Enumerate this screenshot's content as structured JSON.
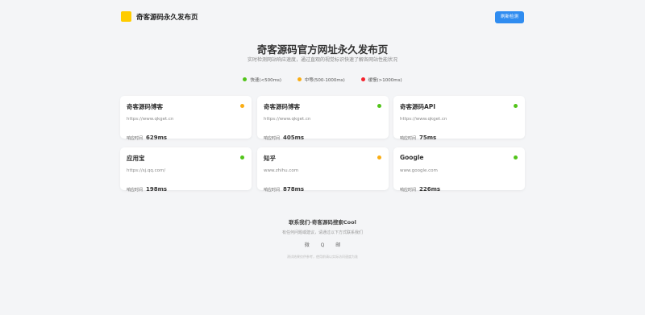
{
  "header": {
    "site_title": "奇客源码永久发布页",
    "refresh_label": "刷新检测",
    "logo_color": "#ffcc00",
    "refresh_color": "#2f8cf0"
  },
  "main": {
    "title": "奇客源码官方网址永久发布页",
    "subtitle": "实时检测网站响应速度，通过直观的视觉标识快速了解各网站性能状况"
  },
  "legend": [
    {
      "label": "快速(<500ms)",
      "color": "#52c41a"
    },
    {
      "label": "中等(500-1000ms)",
      "color": "#faad14"
    },
    {
      "label": "缓慢(>1000ms)",
      "color": "#f5222d"
    }
  ],
  "response_label": "响应时间",
  "sites": [
    {
      "name": "奇客源码博客",
      "url": "https://www.qkget.cn",
      "time": "629ms",
      "status": "medium",
      "color": "#faad14"
    },
    {
      "name": "奇客源码博客",
      "url": "https://www.qkget.cn",
      "time": "405ms",
      "status": "fast",
      "color": "#52c41a"
    },
    {
      "name": "奇客源码API",
      "url": "https://www.qkget.cn",
      "time": "75ms",
      "status": "fast",
      "color": "#52c41a"
    },
    {
      "name": "应用宝",
      "url": "https://sj.qq.com/",
      "time": "198ms",
      "status": "fast",
      "color": "#52c41a"
    },
    {
      "name": "知乎",
      "url": "www.zhihu.com",
      "time": "878ms",
      "status": "medium",
      "color": "#faad14"
    },
    {
      "name": "Google",
      "url": "www.google.com",
      "time": "226ms",
      "status": "fast",
      "color": "#52c41a"
    }
  ],
  "footer": {
    "title": "联系我们-奇客源码搜索Cool",
    "subtitle": "有任何问题或建议，请通过以下方式联系我们",
    "contacts": [
      "微",
      "Q",
      "邮"
    ],
    "note": "测试结果仅供参考，使用前请以实际访问速度为准"
  }
}
